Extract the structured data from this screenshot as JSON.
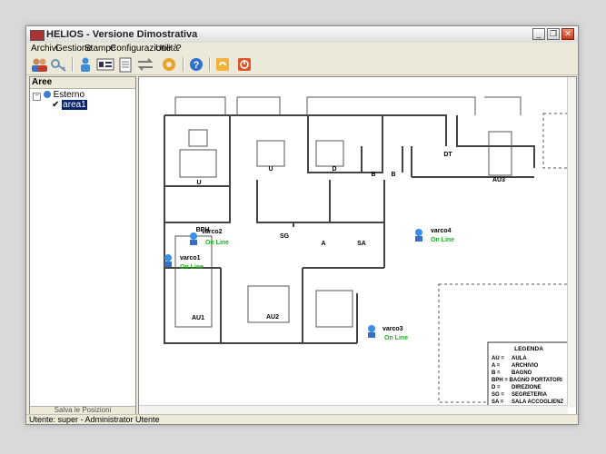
{
  "window": {
    "title": "HELIOS - Versione Dimostrativa"
  },
  "menu": [
    "Archivi",
    "Gestione",
    "Stampe",
    "Configurazione",
    "Utilità",
    "?"
  ],
  "toolbar": [
    {
      "name": "users-icon"
    },
    {
      "name": "key-icon"
    },
    {
      "name": "person-icon"
    },
    {
      "name": "badge-icon"
    },
    {
      "name": "document-icon"
    },
    {
      "name": "transfer-icon"
    },
    {
      "name": "settings-icon"
    },
    {
      "name": "help-icon"
    },
    {
      "name": "lock-icon"
    },
    {
      "name": "power-icon"
    }
  ],
  "sidebar": {
    "title": "Aree",
    "tree": {
      "root": "Esterno",
      "child": "area1"
    },
    "footer": "Salva le Posizioni"
  },
  "map": {
    "rooms": {
      "u1": "U",
      "u2": "U",
      "d": "D",
      "b1": "B",
      "b2": "B",
      "dt": "DT",
      "au3": "AU3",
      "bph": "BPH",
      "sg": "SG",
      "a": "A",
      "sa": "SA",
      "au1": "AU1",
      "au2": "AU2"
    },
    "gates": [
      {
        "name": "varco1",
        "status": "On Line"
      },
      {
        "name": "varco2",
        "status": "On Line"
      },
      {
        "name": "varco3",
        "status": "On Line"
      },
      {
        "name": "varco4",
        "status": "On Line"
      }
    ],
    "legend": {
      "title": "LEGENDA",
      "rows": [
        {
          "code": "AU =",
          "label": "AULA"
        },
        {
          "code": "A =",
          "label": "ARCHIVIO"
        },
        {
          "code": "B =",
          "label": "BAGNO"
        },
        {
          "code": "BPH = BAGNO PORTATORI",
          "label": ""
        },
        {
          "code": "D =",
          "label": "DIREZIONE"
        },
        {
          "code": "SG =",
          "label": "SEGRETERIA"
        },
        {
          "code": "SA =",
          "label": "SALA ACCOGLIENZ"
        }
      ]
    },
    "status_color": "#1fae1f"
  },
  "statusbar": {
    "text": "Utente: super - Administrator Utente"
  }
}
